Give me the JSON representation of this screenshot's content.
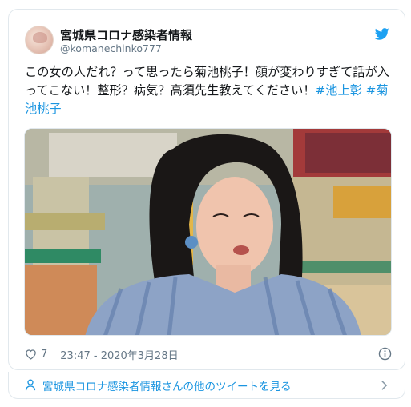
{
  "account": {
    "display_name": "宮城県コロナ感染者情報",
    "handle": "@komanechinko777"
  },
  "tweet": {
    "text_plain": "この女の人だれ？って思ったら菊池桃子！顔が変わりすぎて話が入ってこない！整形？病気？高須先生教えてください！",
    "hashtag_1": "#池上彰",
    "hashtag_2": "#菊池桃子"
  },
  "meta": {
    "like_count": "7",
    "timestamp": "23:47 - 2020年3月28日"
  },
  "footer": {
    "more_tweets_label": "宮城県コロナ感染者情報さんの他のツイートを見る"
  },
  "icons": {
    "logo": "twitter-bird-icon",
    "like": "heart-icon",
    "info": "info-icon",
    "profile": "person-icon",
    "navigate": "chevron-right-icon"
  },
  "colors": {
    "link": "#1b95e0",
    "brand": "#1da1f2",
    "secondary_text": "#657786",
    "border": "#e1e8ed"
  }
}
